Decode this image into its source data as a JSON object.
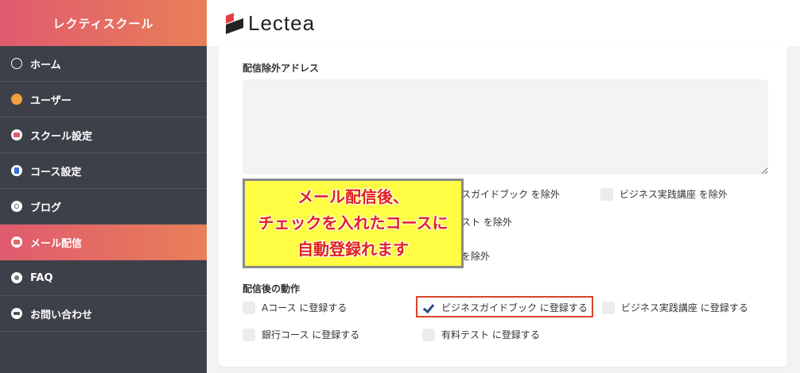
{
  "sidebar": {
    "brand": "レクティスクール",
    "items": [
      {
        "label": "ホーム",
        "icon": "gauge-icon"
      },
      {
        "label": "ユーザー",
        "icon": "user-icon"
      },
      {
        "label": "スクール設定",
        "icon": "school-icon"
      },
      {
        "label": "コース設定",
        "icon": "course-icon"
      },
      {
        "label": "ブログ",
        "icon": "blog-icon"
      },
      {
        "label": "メール配信",
        "icon": "mail-icon",
        "active": true
      },
      {
        "label": "FAQ",
        "icon": "faq-icon"
      },
      {
        "label": "お問い合わせ",
        "icon": "contact-icon"
      }
    ]
  },
  "header": {
    "logo_text": "Lectea"
  },
  "main": {
    "exclude_section_label": "配信除外アドレス",
    "exclude_address_value": "",
    "exclude_options": [
      {
        "label": "ビジネスガイドブック を除外",
        "visible_fragment": "スガイドブック を除外",
        "checked": false
      },
      {
        "label": "ビジネス実践講座 を除外",
        "checked": false
      },
      {
        "label": "有料テスト を除外",
        "visible_fragment": "スト を除外",
        "checked": false
      },
      {
        "label": "を除外",
        "visible_fragment": "を除外",
        "checked": false
      }
    ],
    "after_section_label": "配信後の動作",
    "after_options": [
      {
        "label": "Aコース に登録する",
        "checked": false
      },
      {
        "label": "ビジネスガイドブック に登録する",
        "checked": true
      },
      {
        "label": "ビジネス実践講座 に登録する",
        "checked": false
      },
      {
        "label": "銀行コース に登録する",
        "checked": false
      },
      {
        "label": "有料テスト に登録する",
        "checked": false
      }
    ]
  },
  "callout": {
    "line1": "メール配信後、",
    "line2": "チェックを入れたコースに",
    "line3": "自動登録れます"
  },
  "colors": {
    "accent_gradient_start": "#e05a6e",
    "accent_gradient_end": "#e88058",
    "sidebar_bg": "#3e4049",
    "highlight_border": "#d7442c",
    "callout_bg": "#fffd43",
    "callout_text": "#e02020"
  }
}
